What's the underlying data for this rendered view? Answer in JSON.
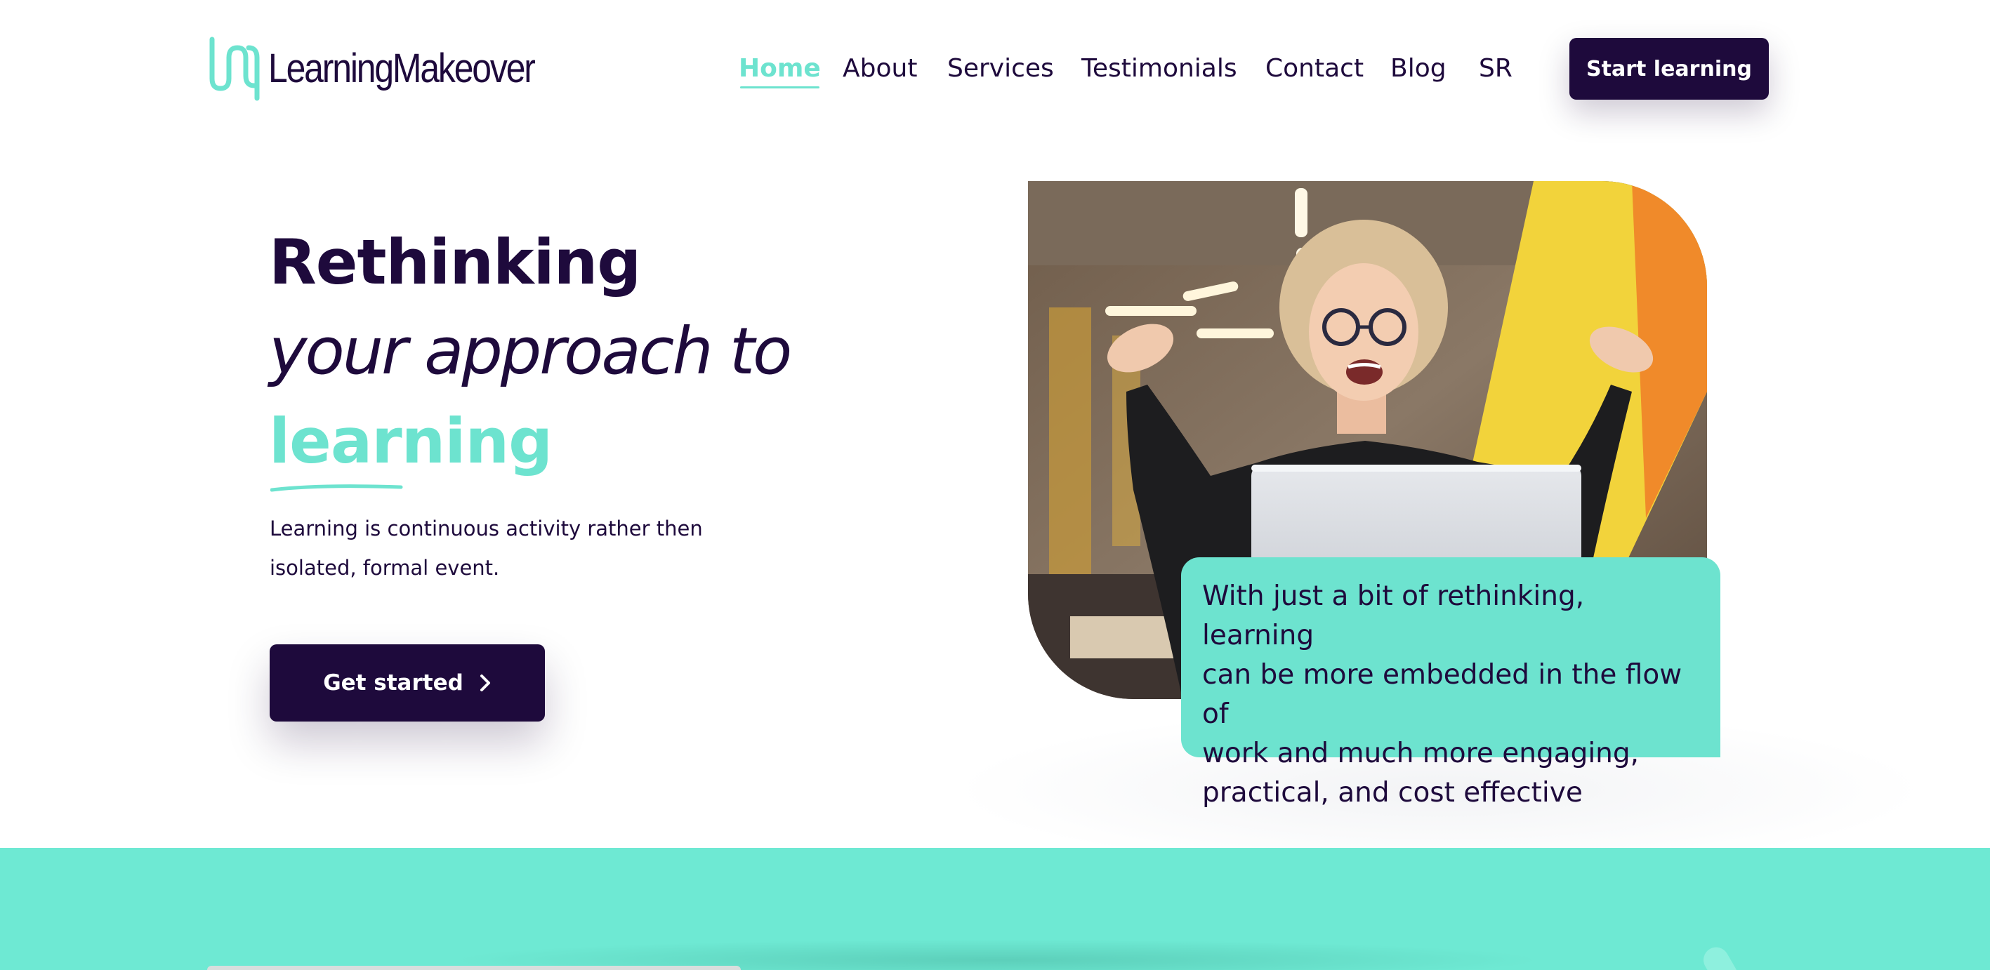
{
  "brand": {
    "name": "LearningMakeover",
    "logo_icon": "wave-logo-icon",
    "primary_color": "#1e0a3c",
    "accent_color": "#6de3cf"
  },
  "nav": {
    "items": [
      {
        "label": "Home",
        "active": true
      },
      {
        "label": "About",
        "active": false
      },
      {
        "label": "Services",
        "active": false
      },
      {
        "label": "Testimonials",
        "active": false
      },
      {
        "label": "Contact",
        "active": false
      },
      {
        "label": "Blog",
        "active": false
      },
      {
        "label": "SR",
        "active": false
      }
    ],
    "cta_label": "Start learning"
  },
  "hero": {
    "headline_line1": "Rethinking",
    "headline_line2": "your approach to",
    "headline_line3": "learning",
    "subtitle_line1": "Learning is continuous activity rather then",
    "subtitle_line2": "isolated, formal event.",
    "cta_label": "Get started",
    "cta_icon": "chevron-right-icon",
    "quote_lines": [
      "With just a bit of rethinking, learning",
      "can be more embedded in the flow of",
      "work and much more engaging,",
      "practical, and cost effective"
    ]
  }
}
